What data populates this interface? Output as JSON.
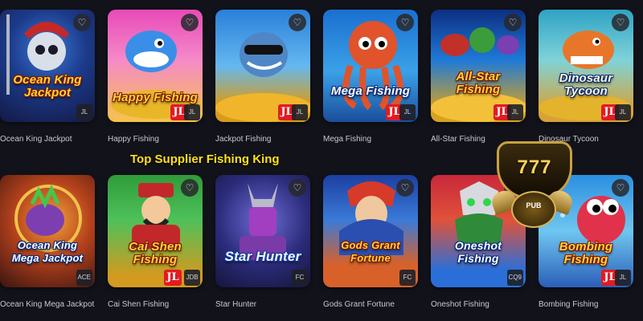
{
  "promo_text": "Top Supplier Fishing King",
  "badge": {
    "number": "777",
    "brand": "PUB"
  },
  "favorite_icon": "heart-outline-icon",
  "games": [
    {
      "title_art": "Ocean King Jackpot",
      "caption": "Ocean King Jackpot",
      "provider": "JL",
      "has_jili_logo": false
    },
    {
      "title_art": "Happy Fishing",
      "caption": "Happy Fishing",
      "provider": "JL",
      "has_jili_logo": true
    },
    {
      "title_art": "",
      "caption": "Jackpot Fishing",
      "provider": "JL",
      "has_jili_logo": true
    },
    {
      "title_art": "Mega Fishing",
      "caption": "Mega Fishing",
      "provider": "JL",
      "has_jili_logo": true
    },
    {
      "title_art": "All-Star Fishing",
      "caption": "All-Star Fishing",
      "provider": "JL",
      "has_jili_logo": true
    },
    {
      "title_art": "Dinosaur Tycoon",
      "caption": "Dinosaur Tycoon",
      "provider": "JL",
      "has_jili_logo": true
    },
    {
      "title_art": "Ocean King Mega Jackpot",
      "caption": "Ocean King Mega Jackpot",
      "provider": "ACE",
      "has_jili_logo": false
    },
    {
      "title_art": "Cai Shen Fishing",
      "caption": "Cai Shen Fishing",
      "provider": "JDB",
      "has_jili_logo": true
    },
    {
      "title_art": "Star Hunter",
      "caption": "Star Hunter",
      "provider": "FC",
      "has_jili_logo": false
    },
    {
      "title_art": "Gods Grant Fortune",
      "caption": "Gods Grant Fortune",
      "provider": "FC",
      "has_jili_logo": false
    },
    {
      "title_art": "Oneshot Fishing",
      "caption": "Oneshot Fishing",
      "provider": "CQ9",
      "has_jili_logo": false
    },
    {
      "title_art": "Bombing Fishing",
      "caption": "Bombing Fishing",
      "provider": "JL",
      "has_jili_logo": true
    }
  ],
  "jili_logo_text": "JL",
  "colors": {
    "background": "#12131a",
    "promo_yellow": "#ffe21a",
    "jili_red": "#e21b22"
  }
}
